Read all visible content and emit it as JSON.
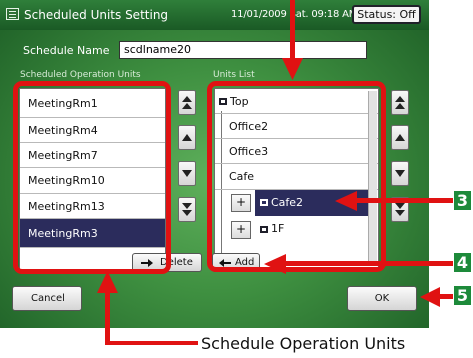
{
  "window": {
    "title": "Scheduled Units Setting",
    "datetime": "11/01/2009 Sat. 09:18 AM",
    "status_button": "Status: Off"
  },
  "schedule": {
    "label": "Schedule Name",
    "value": "scdlname20"
  },
  "operation_units": {
    "heading": "Scheduled Operation Units",
    "items": [
      "MeetingRm1",
      "MeetingRm4",
      "MeetingRm7",
      "MeetingRm10",
      "MeetingRm13",
      "MeetingRm3"
    ],
    "selected": "MeetingRm3"
  },
  "units_list": {
    "heading": "Units List",
    "items": [
      {
        "label": "Top",
        "expander": ""
      },
      {
        "label": "Office2",
        "expander": ""
      },
      {
        "label": "Office3",
        "expander": ""
      },
      {
        "label": "Cafe",
        "expander": ""
      },
      {
        "label": "Cafe2",
        "expander": "+"
      },
      {
        "label": "1F",
        "expander": "+"
      }
    ],
    "selected": "Cafe2"
  },
  "buttons": {
    "delete": "Delete",
    "add": "Add",
    "cancel": "Cancel",
    "ok": "OK"
  },
  "callouts": {
    "n3": "3",
    "n4": "4",
    "n5": "5",
    "caption": "Schedule Operation Units"
  },
  "colors": {
    "callout_red": "#e01212",
    "number_badge": "#1d8a3a",
    "selection": "#2b2c5c"
  }
}
